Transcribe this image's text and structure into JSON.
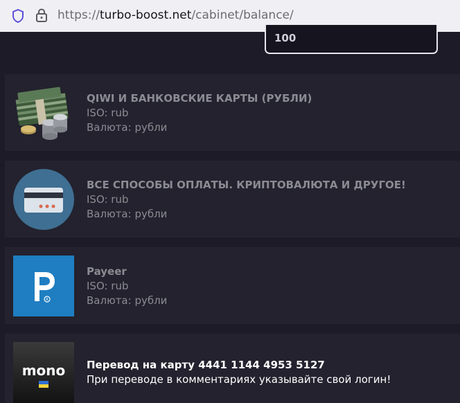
{
  "browser": {
    "url_scheme": "https://",
    "url_host": "turbo-boost.net",
    "url_path": "/cabinet/balance/"
  },
  "amount": {
    "value": "100"
  },
  "payment_methods": [
    {
      "title": "QIWI И БАНКОВСКИЕ КАРТЫ (РУБЛИ)",
      "iso": "ISO: rub",
      "currency": "Валюта: рубли"
    },
    {
      "title": "ВСЕ СПОСОБЫ ОПЛАТЫ. КРИПТОВАЛЮТА И ДРУГОЕ!",
      "iso": "ISO: rub",
      "currency": "Валюта: рубли"
    },
    {
      "title": "Payeer",
      "iso": "ISO: rub",
      "currency": "Валюта: рубли"
    },
    {
      "title": "Перевод на карту 4441 1144 4953 5127",
      "note": "При переводе в комментариях указывайте свой логин!",
      "logo_text": "mono"
    }
  ],
  "colors": {
    "background": "#1c1b27",
    "card": "#23222e",
    "muted_text": "#8b8b93",
    "payeer_blue": "#1f7ec1"
  }
}
